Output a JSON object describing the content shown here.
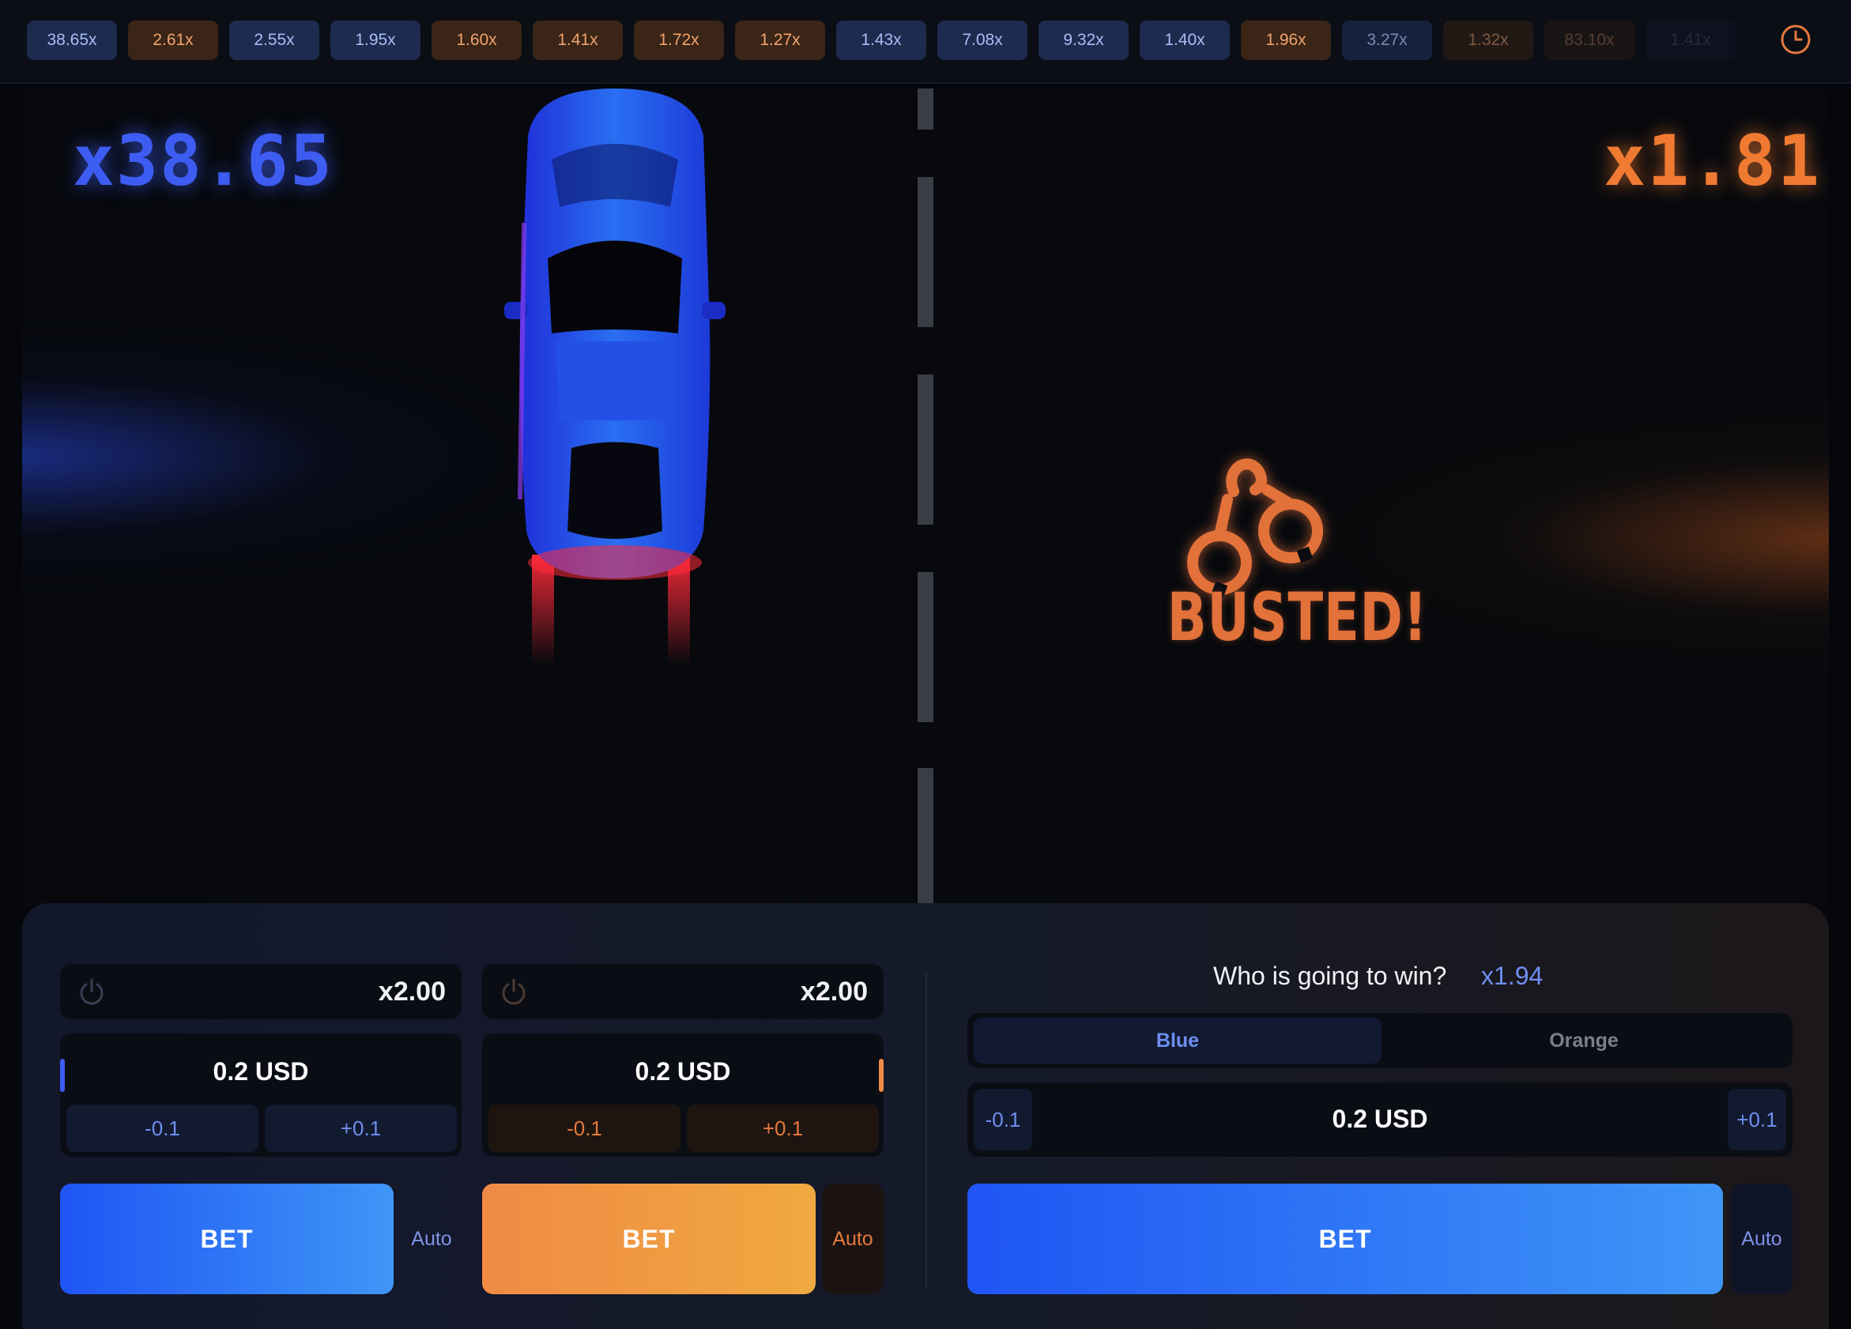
{
  "history": {
    "items": [
      {
        "value": "38.65x",
        "tone": "blue",
        "fade": ""
      },
      {
        "value": "2.61x",
        "tone": "orange",
        "fade": ""
      },
      {
        "value": "2.55x",
        "tone": "blue",
        "fade": ""
      },
      {
        "value": "1.95x",
        "tone": "blue",
        "fade": ""
      },
      {
        "value": "1.60x",
        "tone": "orange",
        "fade": ""
      },
      {
        "value": "1.41x",
        "tone": "orange",
        "fade": ""
      },
      {
        "value": "1.72x",
        "tone": "orange",
        "fade": ""
      },
      {
        "value": "1.27x",
        "tone": "orange",
        "fade": ""
      },
      {
        "value": "1.43x",
        "tone": "blue",
        "fade": ""
      },
      {
        "value": "7.08x",
        "tone": "blue",
        "fade": ""
      },
      {
        "value": "9.32x",
        "tone": "blue",
        "fade": ""
      },
      {
        "value": "1.40x",
        "tone": "blue",
        "fade": ""
      },
      {
        "value": "1.96x",
        "tone": "orange",
        "fade": ""
      },
      {
        "value": "3.27x",
        "tone": "blue",
        "fade": "f1"
      },
      {
        "value": "1.32x",
        "tone": "orange",
        "fade": "f2"
      },
      {
        "value": "83.10x",
        "tone": "orange",
        "fade": "f3"
      },
      {
        "value": "1.41x",
        "tone": "blue",
        "fade": "f4"
      }
    ],
    "history_icon": "clock-icon"
  },
  "game": {
    "blue_multiplier": "x38.65",
    "orange_multiplier": "x1.81",
    "status_text": "BUSTED!",
    "status_icon": "handcuffs-icon",
    "car_icon": "blue-car"
  },
  "bet_panel_1": {
    "power_icon": "power-icon",
    "auto_cashout": "x2.00",
    "amount": "0.2",
    "currency": "USD",
    "decrease": "-0.1",
    "increase": "+0.1",
    "bet_label": "BET",
    "auto_label": "Auto"
  },
  "bet_panel_2": {
    "power_icon": "power-icon",
    "auto_cashout": "x2.00",
    "amount": "0.2",
    "currency": "USD",
    "decrease": "-0.1",
    "increase": "+0.1",
    "bet_label": "BET",
    "auto_label": "Auto"
  },
  "winner_panel": {
    "question": "Who is going to win?",
    "multiplier": "x1.94",
    "options": [
      "Blue",
      "Orange"
    ],
    "selected": "Blue",
    "amount": "0.2",
    "currency": "USD",
    "decrease": "-0.1",
    "increase": "+0.1",
    "bet_label": "BET",
    "auto_label": "Auto"
  },
  "colors": {
    "blue_accent": "#3d5cf2",
    "orange_accent": "#f07a32",
    "background": "#05070c"
  }
}
